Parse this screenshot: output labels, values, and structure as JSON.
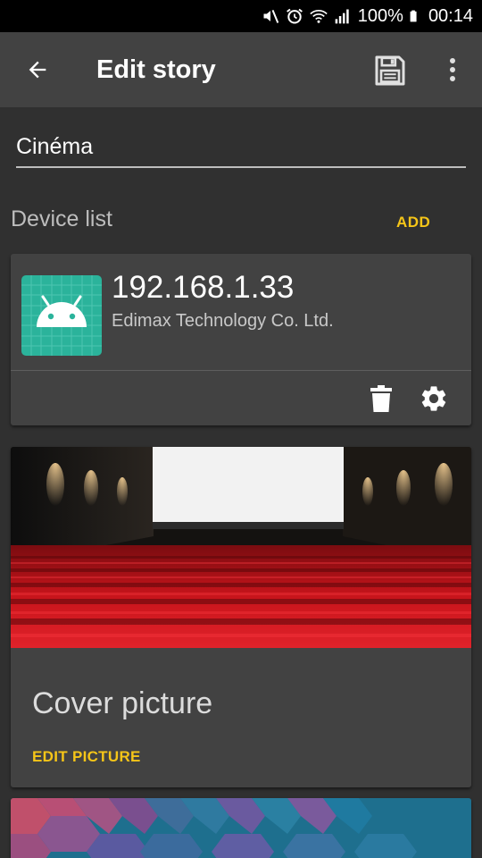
{
  "status_bar": {
    "battery_percent": "100%",
    "time": "00:14",
    "icons": [
      "mute-icon",
      "alarm-icon",
      "wifi-icon",
      "signal-icon",
      "battery-icon"
    ]
  },
  "app_bar": {
    "title": "Edit story",
    "icons": [
      "arrow-back-icon",
      "save-icon",
      "more-vert-icon"
    ]
  },
  "story": {
    "name_value": "Cinéma"
  },
  "device_list": {
    "title": "Device list",
    "add_label": "ADD",
    "devices": [
      {
        "ip": "192.168.1.33",
        "vendor": "Edimax Technology Co. Ltd.",
        "icon": "android-icon",
        "actions": [
          "delete-icon",
          "settings-icon"
        ]
      }
    ]
  },
  "cover": {
    "title": "Cover picture",
    "edit_label": "EDIT PICTURE"
  },
  "colors": {
    "background": "#303030",
    "app_bar": "#424242",
    "card": "#424242",
    "accent": "#f5c518",
    "android_teal": "#2bb39b"
  }
}
